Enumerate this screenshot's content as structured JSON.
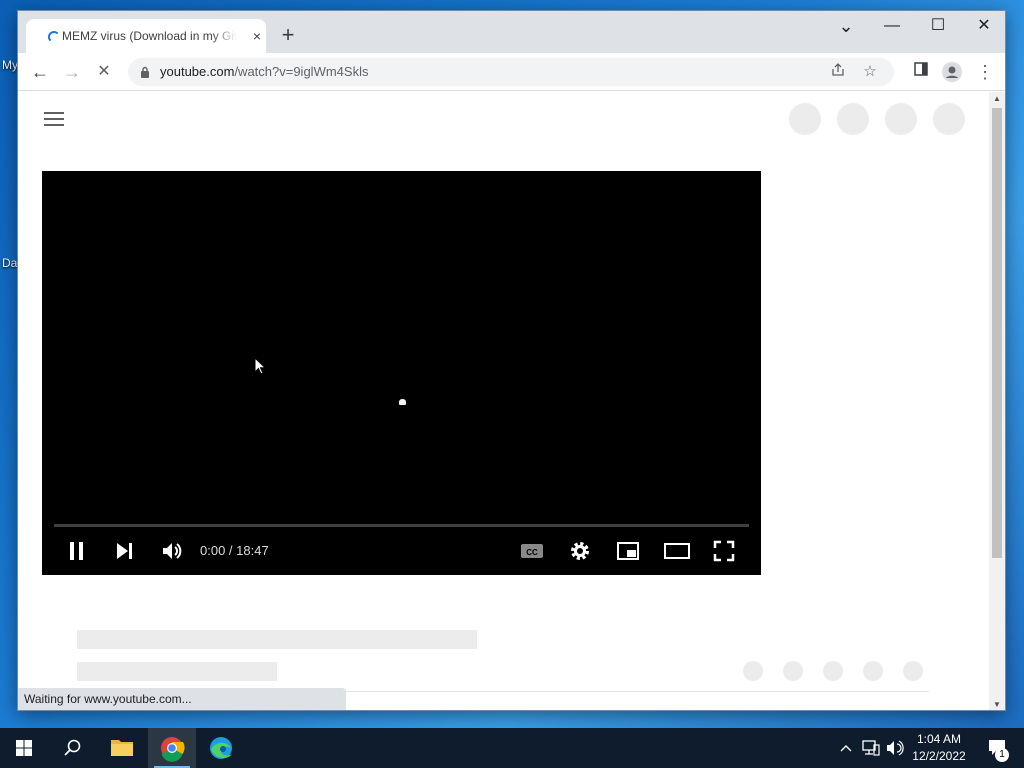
{
  "desktop": {
    "icon_labels": [
      "My",
      "Da"
    ]
  },
  "browser": {
    "tab": {
      "title": "MEMZ virus (Download in my GitHub)",
      "close_glyph": "×"
    },
    "new_tab_glyph": "+",
    "window_controls": {
      "dropdown": "⌄",
      "minimize": "—",
      "maximize": "☐",
      "close": "✕"
    },
    "nav": {
      "back": "←",
      "forward": "→",
      "stop": "✕"
    },
    "address": {
      "host": "youtube.com",
      "path": "/watch?v=9iglWm4Skls"
    },
    "status_text": "Waiting for www.youtube.com..."
  },
  "player": {
    "time_display": "0:00 / 18:47",
    "progress": 0,
    "controls": [
      "pause-icon",
      "next-icon",
      "volume-icon",
      "cc-icon",
      "settings-icon",
      "miniplayer-icon",
      "theater-icon",
      "fullscreen-icon"
    ]
  },
  "taskbar": {
    "apps": [
      "start",
      "search",
      "file-explorer",
      "chrome",
      "edge"
    ],
    "clock_time": "1:04 AM",
    "clock_date": "12/2/2022",
    "notification_count": "1"
  },
  "colors": {
    "placeholder": "#ececec",
    "player_bg": "#000000",
    "taskbar_bg": "#0f1c2d",
    "accent": "#1a73e8"
  }
}
